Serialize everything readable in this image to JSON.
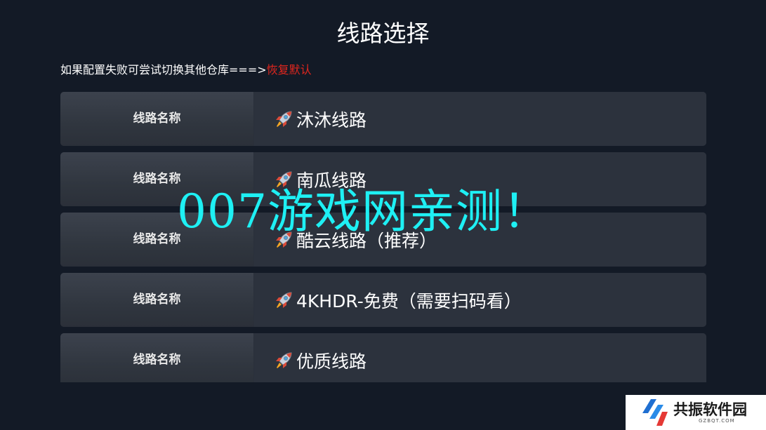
{
  "header": {
    "title": "线路选择"
  },
  "hint": {
    "text": "如果配置失败可尝试切换其他仓库===>",
    "restore_label": "恢复默认"
  },
  "routes": [
    {
      "label": "线路名称",
      "name": "沐沐线路",
      "icon": "rocket-icon"
    },
    {
      "label": "线路名称",
      "name": "南瓜线路",
      "icon": "rocket-icon"
    },
    {
      "label": "线路名称",
      "name": "酷云线路（推荐）",
      "icon": "rocket-icon"
    },
    {
      "label": "线路名称",
      "name": "4KHDR-免费（需要扫码看）",
      "icon": "rocket-icon"
    },
    {
      "label": "线路名称",
      "name": "优质线路",
      "icon": "rocket-icon"
    }
  ],
  "watermark": {
    "text": "007游戏网亲测！"
  },
  "logo": {
    "text": "共振软件园",
    "subtext": "GZBQT.COM"
  },
  "colors": {
    "background": "#131a26",
    "restore_link": "#e0261e",
    "watermark": "#1ef0f4"
  }
}
